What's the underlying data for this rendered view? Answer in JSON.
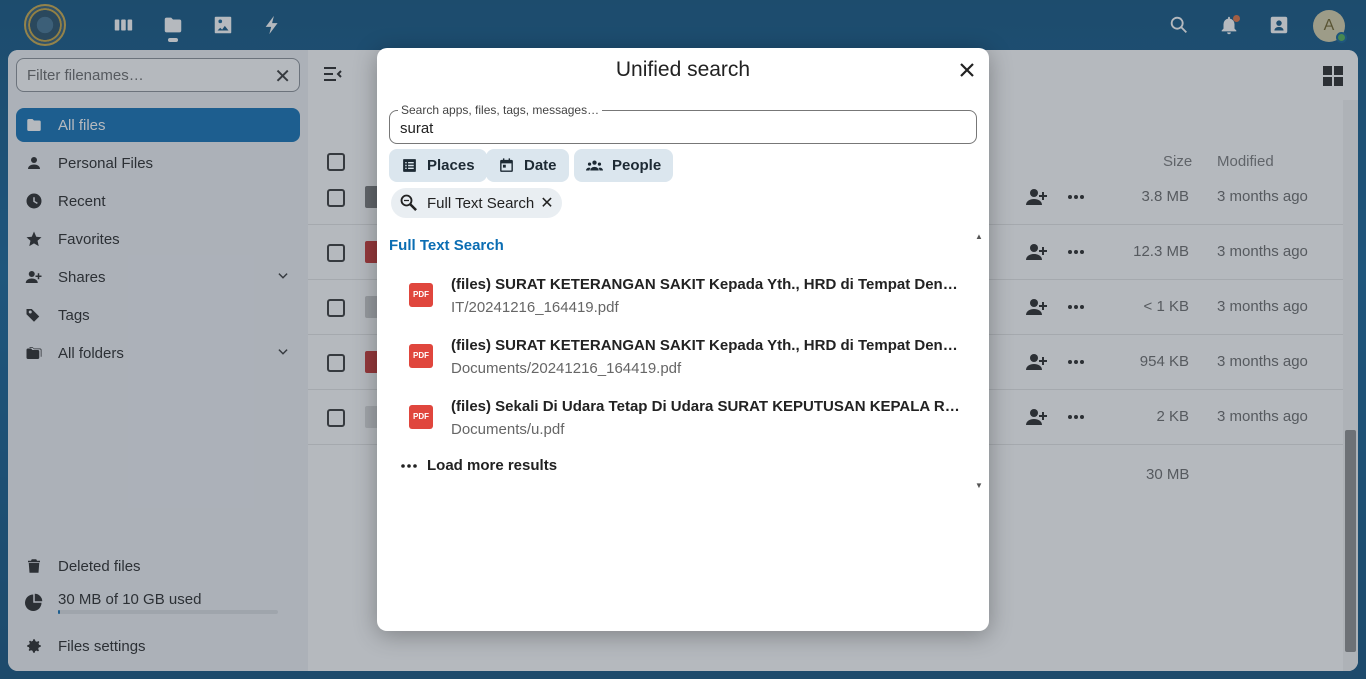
{
  "header": {
    "apps": [
      "dashboard",
      "files",
      "photos",
      "activity"
    ]
  },
  "avatar": {
    "initial": "A"
  },
  "sidebar": {
    "filter_placeholder": "Filter filenames…",
    "items": [
      {
        "label": "All files",
        "icon": "folder-icon",
        "active": true
      },
      {
        "label": "Personal Files",
        "icon": "person-icon"
      },
      {
        "label": "Recent",
        "icon": "clock-icon"
      },
      {
        "label": "Favorites",
        "icon": "star-icon"
      },
      {
        "label": "Shares",
        "icon": "share-icon",
        "expandable": true
      },
      {
        "label": "Tags",
        "icon": "tag-icon"
      },
      {
        "label": "All folders",
        "icon": "folders-icon",
        "expandable": true
      }
    ],
    "deleted_files": "Deleted files",
    "quota": "30 MB of 10 GB used",
    "quota_used_fraction": 0.003,
    "settings": "Files settings"
  },
  "file_list": {
    "columns": {
      "size": "Size",
      "modified": "Modified"
    },
    "rows": [
      {
        "size": "3.8 MB",
        "modified": "3 months ago"
      },
      {
        "size": "12.3 MB",
        "modified": "3 months ago"
      },
      {
        "size": "< 1 KB",
        "modified": "3 months ago"
      },
      {
        "size": "954 KB",
        "modified": "3 months ago"
      },
      {
        "size": "2 KB",
        "modified": "3 months ago"
      }
    ],
    "total": "30 MB"
  },
  "modal": {
    "title": "Unified search",
    "search_label": "Search apps, files, tags, messages…",
    "search_value": "surat",
    "filters": {
      "places": "Places",
      "date": "Date",
      "people": "People"
    },
    "active_filter": "Full Text Search",
    "section_title": "Full Text Search",
    "results": [
      {
        "title": "(files) SURAT KETERANGAN SAKIT Kepada Yth., HRD di Tempat Dengan …",
        "subtitle": "IT/20241216_164419.pdf"
      },
      {
        "title": "(files) SURAT KETERANGAN SAKIT Kepada Yth., HRD di Tempat Dengan …",
        "subtitle": "Documents/20241216_164419.pdf"
      },
      {
        "title": "(files) Sekali Di Udara Tetap Di Udara SURAT KEPUTUSAN KEPALA RRI BA…",
        "subtitle": "Documents/u.pdf"
      }
    ],
    "pdf_badge": "PDF",
    "load_more": "Load more results"
  },
  "colors": {
    "primary": "#0a6db3",
    "pdf": "#e0463d"
  }
}
